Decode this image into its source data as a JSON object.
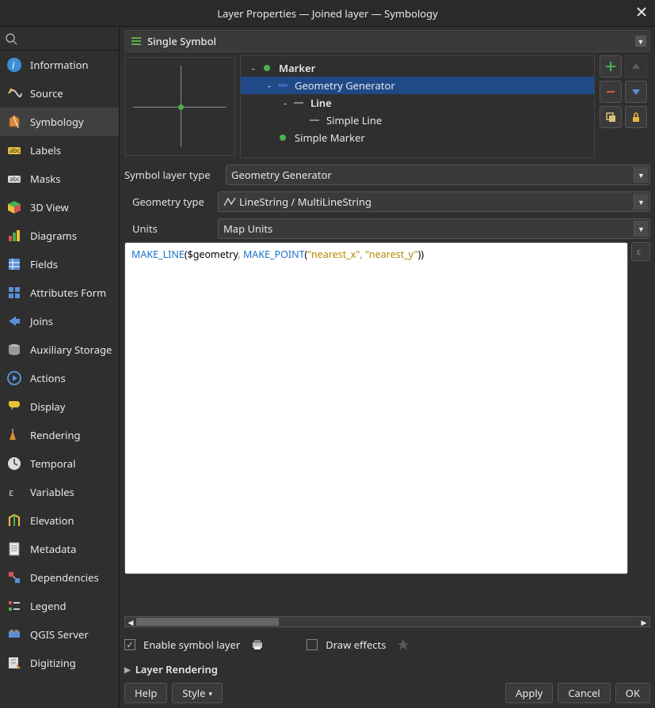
{
  "window": {
    "title": "Layer Properties — Joined layer — Symbology"
  },
  "sidebar": {
    "search_placeholder": "",
    "items": [
      {
        "label": "Information"
      },
      {
        "label": "Source"
      },
      {
        "label": "Symbology"
      },
      {
        "label": "Labels"
      },
      {
        "label": "Masks"
      },
      {
        "label": "3D View"
      },
      {
        "label": "Diagrams"
      },
      {
        "label": "Fields"
      },
      {
        "label": "Attributes Form"
      },
      {
        "label": "Joins"
      },
      {
        "label": "Auxiliary Storage"
      },
      {
        "label": "Actions"
      },
      {
        "label": "Display"
      },
      {
        "label": "Rendering"
      },
      {
        "label": "Temporal"
      },
      {
        "label": "Variables"
      },
      {
        "label": "Elevation"
      },
      {
        "label": "Metadata"
      },
      {
        "label": "Dependencies"
      },
      {
        "label": "Legend"
      },
      {
        "label": "QGIS Server"
      },
      {
        "label": "Digitizing"
      }
    ],
    "selected_index": 2
  },
  "symbol_selector": {
    "label": "Single Symbol"
  },
  "tree": {
    "items": [
      {
        "label": "Marker",
        "depth": 0,
        "bold": true,
        "icon": "point-icon",
        "expander": "-"
      },
      {
        "label": "Geometry Generator",
        "depth": 1,
        "bold": false,
        "icon": "line-blue-icon",
        "expander": "-",
        "selected": true
      },
      {
        "label": "Line",
        "depth": 2,
        "bold": true,
        "icon": "line-icon",
        "expander": "-"
      },
      {
        "label": "Simple Line",
        "depth": 3,
        "bold": false,
        "icon": "line-icon",
        "expander": ""
      },
      {
        "label": "Simple Marker",
        "depth": 1,
        "bold": false,
        "icon": "point-icon",
        "expander": ""
      }
    ]
  },
  "form": {
    "symbol_layer_type_label": "Symbol layer type",
    "symbol_layer_type_value": "Geometry Generator",
    "geometry_type_label": "Geometry type",
    "geometry_type_value": "LineString / MultiLineString",
    "units_label": "Units",
    "units_value": "Map Units"
  },
  "expression": {
    "tokens": [
      {
        "t": "MAKE_LINE",
        "c": "fn"
      },
      {
        "t": "(",
        "c": "pn"
      },
      {
        "t": "$geometry",
        "c": "var"
      },
      {
        "t": ", ",
        "c": "comma"
      },
      {
        "t": "MAKE_POINT",
        "c": "fn"
      },
      {
        "t": "(",
        "c": "pn"
      },
      {
        "t": "\"nearest_x\"",
        "c": "str"
      },
      {
        "t": ", ",
        "c": "comma"
      },
      {
        "t": "\"nearest_y\"",
        "c": "str"
      },
      {
        "t": ")",
        "c": "pn"
      },
      {
        "t": ")",
        "c": "pn"
      }
    ]
  },
  "options": {
    "enable_label": "Enable symbol layer",
    "enable_checked": true,
    "draw_effects_label": "Draw effects",
    "draw_effects_checked": false
  },
  "section": {
    "layer_rendering": "Layer Rendering"
  },
  "footer": {
    "help": "Help",
    "style": "Style",
    "apply": "Apply",
    "cancel": "Cancel",
    "ok": "OK"
  }
}
